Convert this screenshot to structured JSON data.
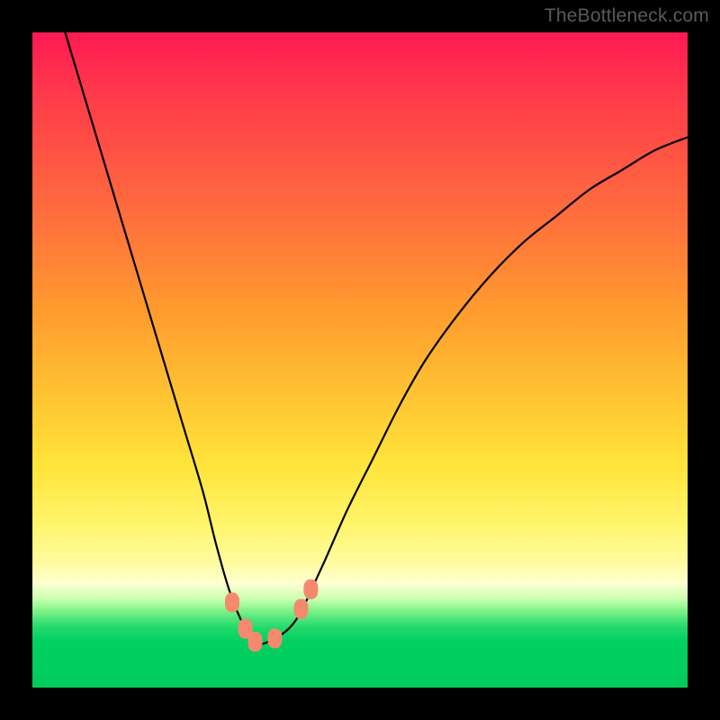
{
  "watermark": "TheBottleneck.com",
  "chart_data": {
    "type": "line",
    "title": "",
    "xlabel": "",
    "ylabel": "",
    "xlim": [
      0,
      100
    ],
    "ylim": [
      0,
      100
    ],
    "grid": false,
    "legend": false,
    "series": [
      {
        "name": "bottleneck-curve",
        "color": "#000000",
        "x": [
          5,
          8,
          11,
          14,
          17,
          20,
          23,
          26,
          28,
          30,
          32,
          34,
          36,
          40,
          44,
          48,
          52,
          56,
          60,
          65,
          70,
          75,
          80,
          85,
          90,
          95,
          100
        ],
        "y": [
          100,
          90,
          80,
          70,
          60,
          50,
          40,
          30,
          22,
          15,
          10,
          7,
          7,
          10,
          18,
          27,
          35,
          43,
          50,
          57,
          63,
          68,
          72,
          76,
          79,
          82,
          84
        ]
      }
    ],
    "markers": [
      {
        "name": "marker-left-1",
        "x": 30.5,
        "y": 13,
        "color": "#f5896e"
      },
      {
        "name": "marker-left-2",
        "x": 32.5,
        "y": 9,
        "color": "#f5896e"
      },
      {
        "name": "marker-bottom-1",
        "x": 34,
        "y": 7,
        "color": "#f5896e"
      },
      {
        "name": "marker-bottom-2",
        "x": 37,
        "y": 7.5,
        "color": "#f5896e"
      },
      {
        "name": "marker-right-1",
        "x": 41,
        "y": 12,
        "color": "#f5896e"
      },
      {
        "name": "marker-right-2",
        "x": 42.5,
        "y": 15,
        "color": "#f5896e"
      }
    ],
    "background_gradient": {
      "top": "#ff1a53",
      "mid": "#ffe43a",
      "bottom": "#00cc5c"
    }
  }
}
